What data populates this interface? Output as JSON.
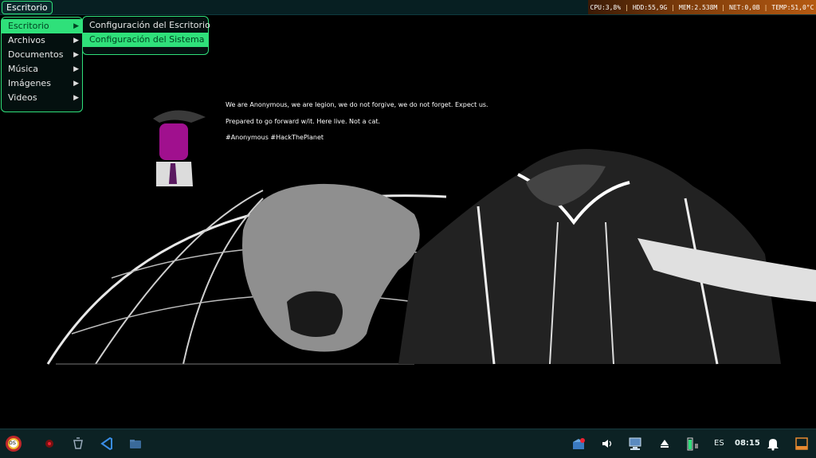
{
  "topbar": {
    "menu_button": "Escritorio",
    "sysmon": {
      "cpu": "CPU:3,8%",
      "hdd": "HDD:55,9G",
      "mem": "MEM:2.538M",
      "net": "NET:0,0B",
      "temp": "TEMP:51,0°C",
      "separator": "|"
    }
  },
  "main_menu": {
    "items": [
      {
        "label": "Escritorio"
      },
      {
        "label": "Archivos"
      },
      {
        "label": "Documentos"
      },
      {
        "label": "Música"
      },
      {
        "label": "Imágenes"
      },
      {
        "label": "Videos"
      }
    ],
    "arrow": "▶"
  },
  "sub_menu": {
    "items": [
      {
        "label": "Configuración del Escritorio"
      },
      {
        "label": "Configuración del Sistema"
      }
    ]
  },
  "wallpaper": {
    "line1": "We are Anonymous, we are legion, we do not forgive, we do not forget. Expect us.",
    "line2": "Prepared to go forward w/it. Here live. Not a cat.",
    "line3": "#Anonymous #HackThePlanet"
  },
  "taskbar": {
    "start_logo_text": "os",
    "keyboard_layout": "ES",
    "clock": "08:15"
  },
  "colors": {
    "accent": "#2fe07a",
    "bar_bg": "#0c2224",
    "sysmon_bg": "#b55a12"
  }
}
